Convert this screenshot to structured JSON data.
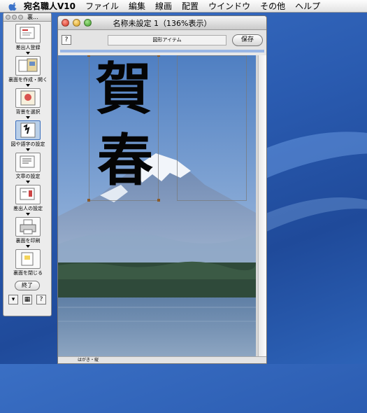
{
  "menubar": {
    "app_name": "宛名職人V10",
    "items": [
      "ファイル",
      "編集",
      "線画",
      "配置",
      "ウインドウ",
      "その他",
      "ヘルプ"
    ]
  },
  "palette": {
    "title": "裏...",
    "tools": [
      {
        "label": "差出人登録",
        "icon": "address-card-icon"
      },
      {
        "label": "裏面を作成・開く",
        "icon": "open-card-icon"
      },
      {
        "label": "背景を選択",
        "icon": "background-icon"
      },
      {
        "label": "図や語字の設定",
        "icon": "figure-settings-icon"
      },
      {
        "label": "文章の設定",
        "icon": "text-settings-icon"
      },
      {
        "label": "差出人の設定",
        "icon": "sender-settings-icon"
      },
      {
        "label": "裏面を印刷",
        "icon": "printer-icon"
      },
      {
        "label": "裏面を閉じる",
        "icon": "close-card-icon"
      }
    ],
    "end_label": "終了",
    "bottom_help": "?"
  },
  "window": {
    "title": "名称未設定 1（136%表示）",
    "help": "?",
    "item_field": "図形アイテム",
    "save_label": "保存",
    "status": "はがき・縦"
  },
  "card": {
    "kanji1": "賀",
    "kanji2": "春"
  },
  "colors": {
    "desktop": "#2a5bb0",
    "ruler": "#9ab7e5",
    "selected_tool": "#b9cfe8"
  }
}
